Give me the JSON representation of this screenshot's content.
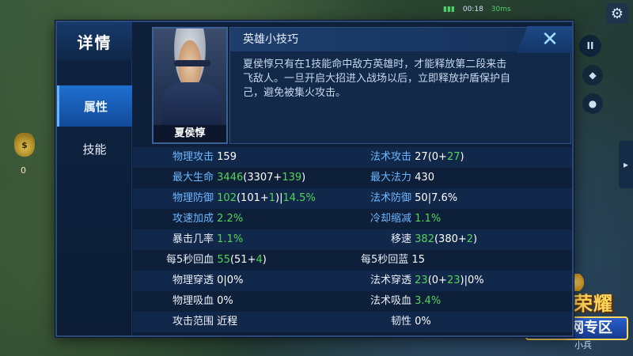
{
  "hud": {
    "timer": "00:18",
    "fps": "30ms",
    "settings_icon": "gear-icon",
    "pause_label": "II",
    "gold_symbol": "$",
    "gold_count": "0",
    "minion_label": "小兵"
  },
  "logo": {
    "line1": "王者荣耀",
    "line2": "魔方网专区"
  },
  "panel": {
    "title": "详情",
    "close_label": "✕",
    "tabs": [
      {
        "label": "属性",
        "active": true
      },
      {
        "label": "技能",
        "active": false
      }
    ],
    "hero_name": "夏侯惇",
    "tip_title": "英雄小技巧",
    "tip_text": "夏侯惇只有在1技能命中敌方英雄时，才能释放第二段来击飞敌人。一旦开启大招进入战场以后，立即释放护盾保护自己，避免被集火攻击。"
  },
  "stats": {
    "rows": [
      {
        "left": {
          "label": "物理攻击",
          "segments": [
            {
              "t": "159",
              "c": "val"
            }
          ]
        },
        "right": {
          "label": "法术攻击",
          "segments": [
            {
              "t": "27(0+",
              "c": "val"
            },
            {
              "t": "27",
              "c": "bonus"
            },
            {
              "t": ")",
              "c": "val"
            }
          ]
        }
      },
      {
        "left": {
          "label": "最大生命",
          "segments": [
            {
              "t": "3446",
              "c": "bonus"
            },
            {
              "t": "(3307+",
              "c": "val"
            },
            {
              "t": "139",
              "c": "bonus"
            },
            {
              "t": ")",
              "c": "val"
            }
          ]
        },
        "right": {
          "label": "最大法力",
          "segments": [
            {
              "t": "430",
              "c": "val"
            }
          ]
        }
      },
      {
        "left": {
          "label": "物理防御",
          "segments": [
            {
              "t": "102",
              "c": "bonus"
            },
            {
              "t": "(101+",
              "c": "val"
            },
            {
              "t": "1",
              "c": "bonus"
            },
            {
              "t": ")|",
              "c": "val"
            },
            {
              "t": "14.5%",
              "c": "bonus"
            }
          ]
        },
        "right": {
          "label": "法术防御",
          "segments": [
            {
              "t": "50|7.6%",
              "c": "val"
            }
          ]
        }
      },
      {
        "left": {
          "label": "攻速加成",
          "segments": [
            {
              "t": "2.2%",
              "c": "bonus"
            }
          ]
        },
        "right": {
          "label": "冷却缩减",
          "segments": [
            {
              "t": "1.1%",
              "c": "bonus"
            }
          ]
        }
      },
      {
        "left": {
          "label": "暴击几率",
          "segments": [
            {
              "t": "1.1%",
              "c": "bonus"
            }
          ]
        },
        "right": {
          "label": "移速",
          "segments": [
            {
              "t": "382",
              "c": "bonus"
            },
            {
              "t": "(380+",
              "c": "val"
            },
            {
              "t": "2",
              "c": "bonus"
            },
            {
              "t": ")",
              "c": "val"
            }
          ]
        }
      },
      {
        "left": {
          "label": "每5秒回血",
          "segments": [
            {
              "t": "55",
              "c": "bonus"
            },
            {
              "t": "(51+",
              "c": "val"
            },
            {
              "t": "4",
              "c": "bonus"
            },
            {
              "t": ")",
              "c": "val"
            }
          ]
        },
        "right": {
          "label": "每5秒回蓝",
          "segments": [
            {
              "t": "15",
              "c": "val"
            }
          ]
        }
      },
      {
        "left": {
          "label": "物理穿透",
          "segments": [
            {
              "t": "0|0%",
              "c": "val"
            }
          ]
        },
        "right": {
          "label": "法术穿透",
          "segments": [
            {
              "t": "23",
              "c": "bonus"
            },
            {
              "t": "(0+",
              "c": "val"
            },
            {
              "t": "23",
              "c": "bonus"
            },
            {
              "t": ")|0%",
              "c": "val"
            }
          ]
        }
      },
      {
        "left": {
          "label": "物理吸血",
          "segments": [
            {
              "t": "0%",
              "c": "val"
            }
          ]
        },
        "right": {
          "label": "法术吸血",
          "segments": [
            {
              "t": "3.4%",
              "c": "bonus"
            }
          ]
        }
      },
      {
        "left": {
          "label": "攻击范围",
          "segments": [
            {
              "t": "近程",
              "c": "val"
            }
          ]
        },
        "right": {
          "label": "韧性",
          "segments": [
            {
              "t": "0%",
              "c": "val"
            }
          ]
        }
      }
    ]
  }
}
